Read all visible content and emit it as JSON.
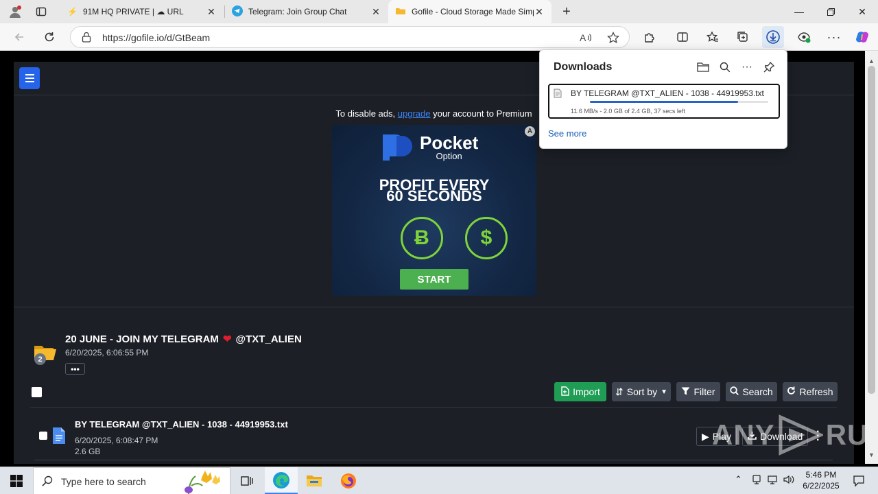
{
  "browser": {
    "tabs": [
      {
        "title": "91M HQ PRIVATE | ☁ URL",
        "icon": "lightning-icon",
        "active": false
      },
      {
        "title": "Telegram: Join Group Chat",
        "icon": "telegram-icon",
        "active": false
      },
      {
        "title": "Gofile - Cloud Storage Made Simp",
        "icon": "gofile-icon",
        "active": true
      }
    ],
    "url": "https://gofile.io/d/GtBeam"
  },
  "page": {
    "ad_note_prefix": "To disable ads,",
    "ad_note_link": "upgrade",
    "ad_note_suffix": "your account to Premium",
    "ad": {
      "brand": "Pocket",
      "brand_sub": "Option",
      "headline_1": "PROFIT EVERY",
      "headline_2": "60 SECONDS",
      "coin_1": "Ƀ",
      "coin_2": "$",
      "cta": "START",
      "corner": "A"
    },
    "folder": {
      "title": "20 JUNE - JOIN MY TELEGRAM",
      "heart": "❤",
      "handle": "@TXT_ALIEN",
      "date": "6/20/2025, 6:06:55 PM",
      "count": "2",
      "more": "•••"
    },
    "actions": {
      "import": "Import",
      "sort": "Sort by",
      "filter": "Filter",
      "search": "Search",
      "refresh": "Refresh"
    },
    "file": {
      "name": "BY TELEGRAM @TXT_ALIEN - 1038 - 44919953.txt",
      "date": "6/20/2025, 6:08:47 PM",
      "size": "2.6 GB",
      "play": "Play",
      "download": "Download"
    },
    "watermark_left": "ANY",
    "watermark_right": "RUN"
  },
  "downloads": {
    "title": "Downloads",
    "item_name": "BY TELEGRAM @TXT_ALIEN - 1038 - 44919953.txt",
    "item_status": "11.6 MB/s - 2.0 GB of 2.4 GB, 37 secs left",
    "progress": 0.83,
    "see_more": "See more"
  },
  "taskbar": {
    "search_placeholder": "Type here to search",
    "time": "5:46 PM",
    "date": "6/22/2025"
  }
}
